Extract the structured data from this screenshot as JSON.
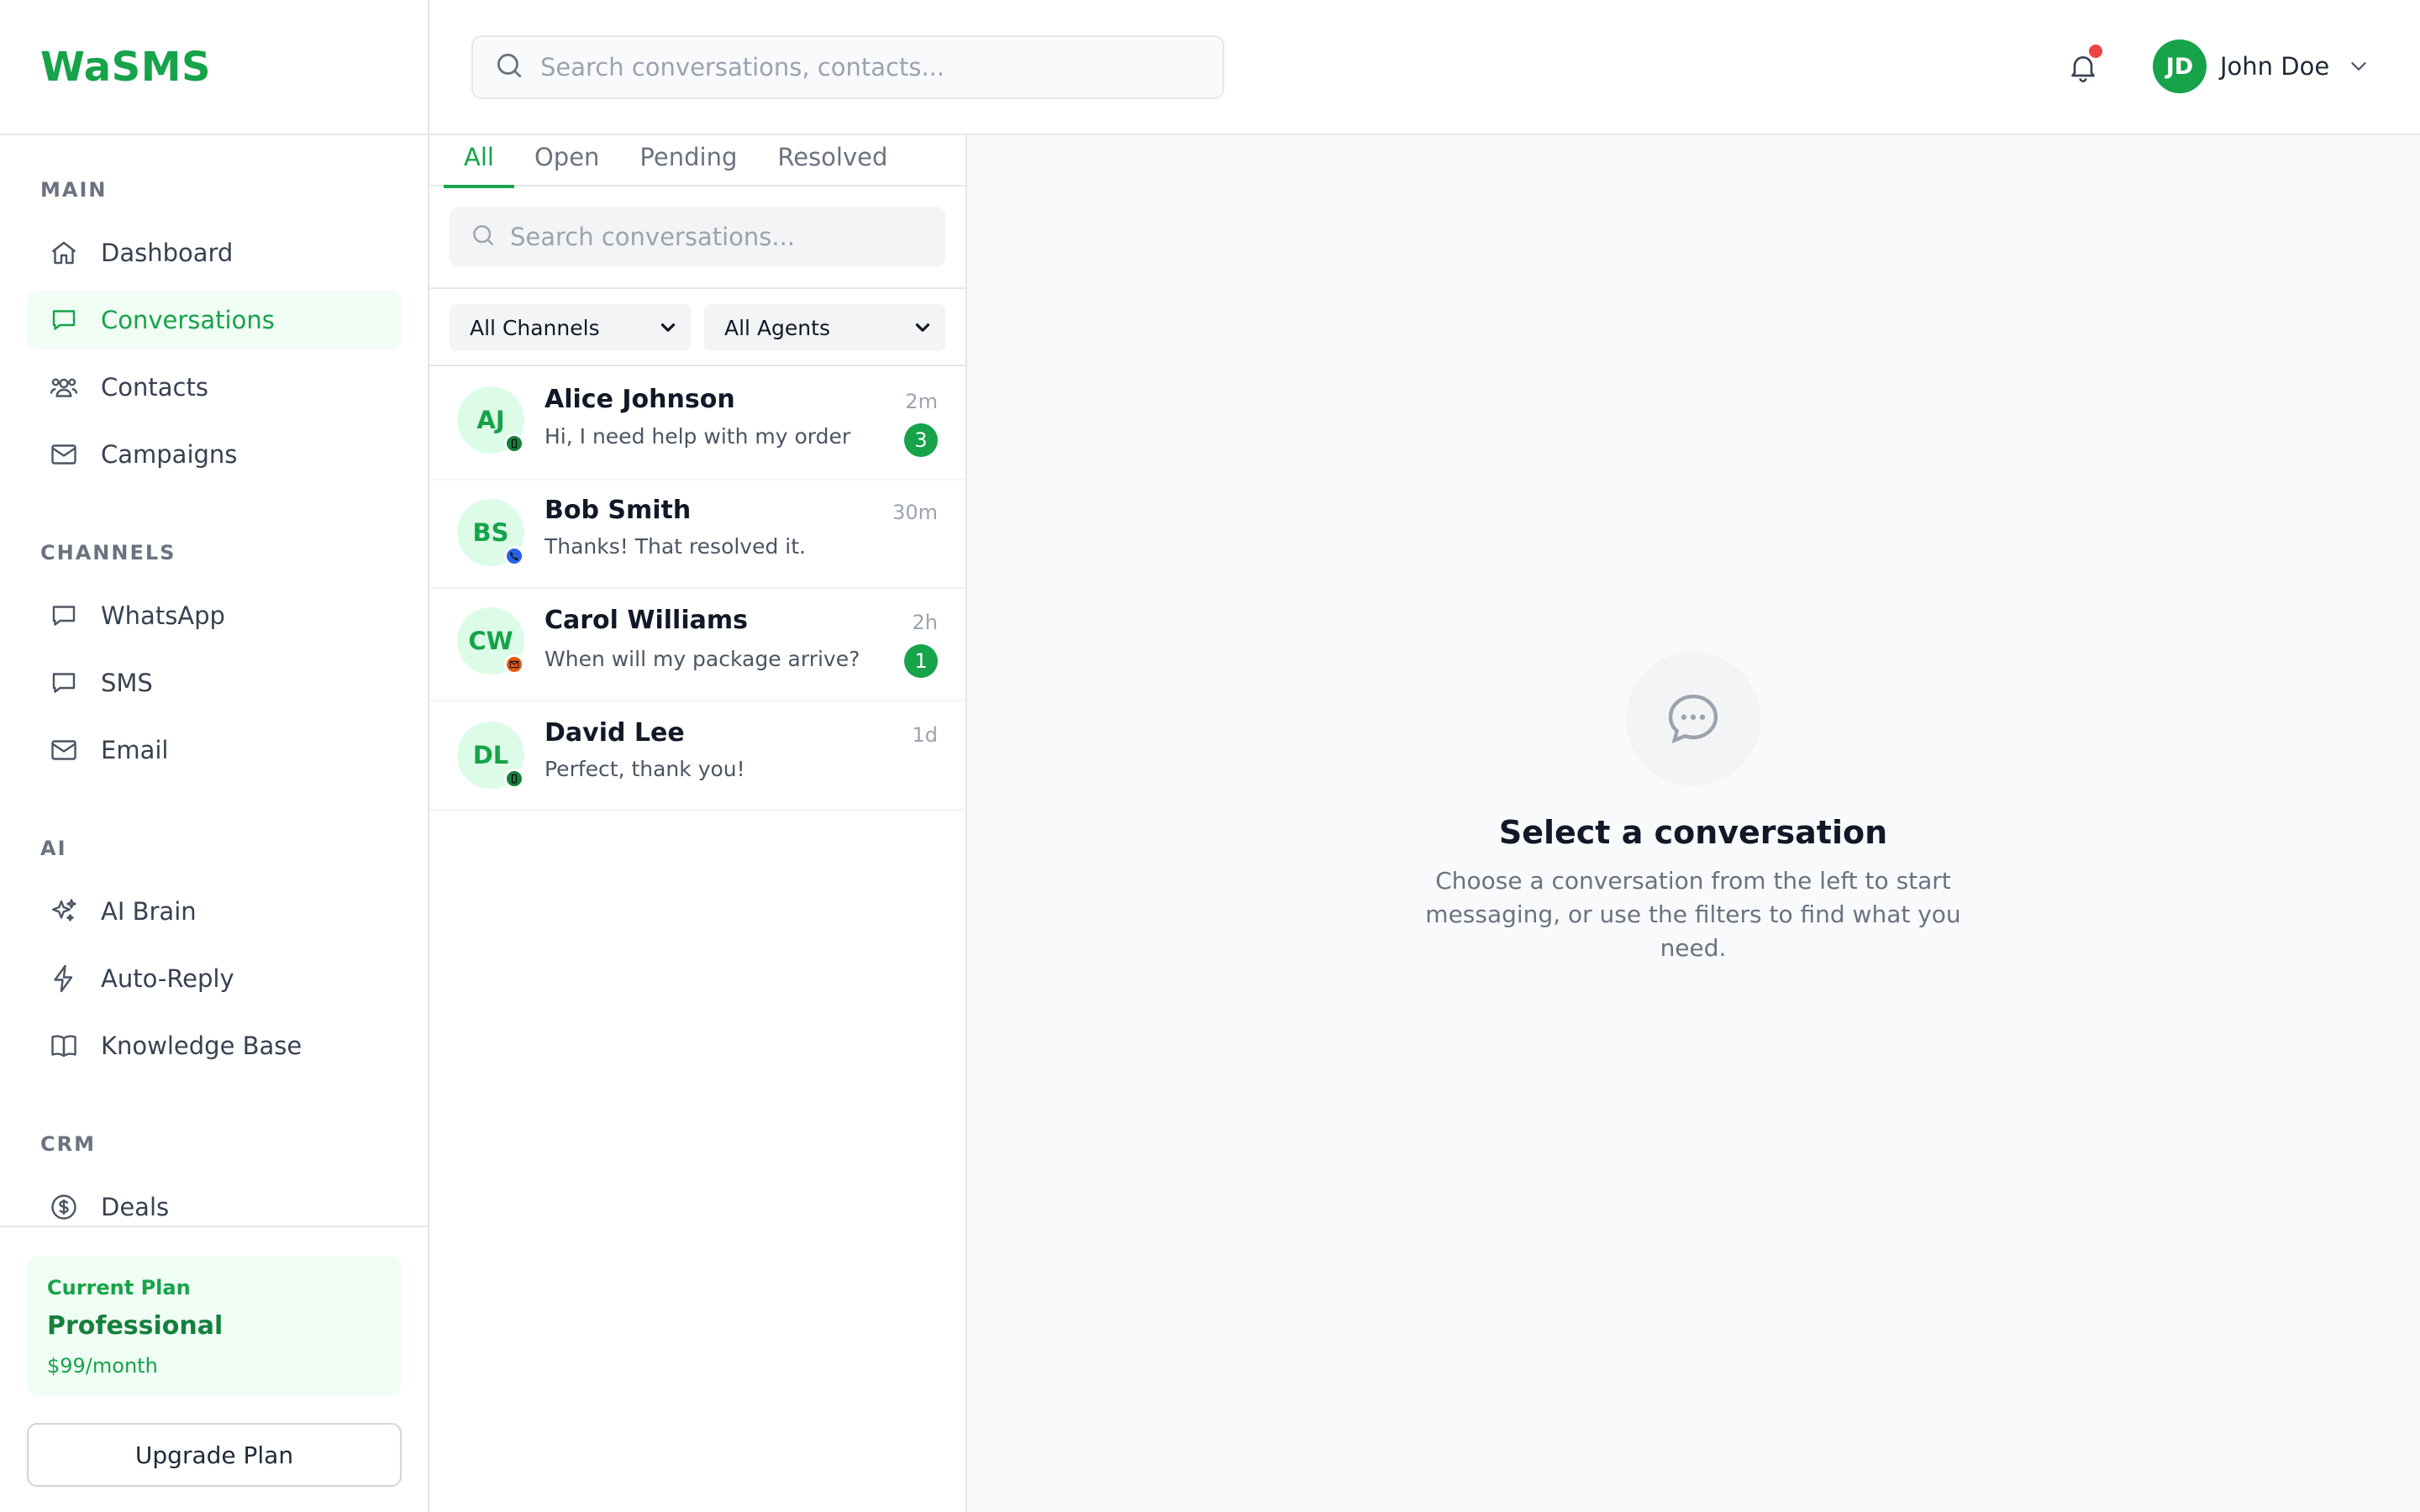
{
  "app": {
    "brand": "WaSMS"
  },
  "header": {
    "search_placeholder": "Search conversations, contacts...",
    "user": {
      "initials": "JD",
      "name": "John Doe"
    }
  },
  "sidebar": {
    "sections": [
      {
        "title": "MAIN",
        "items": [
          {
            "label": "Dashboard",
            "icon": "home-icon"
          },
          {
            "label": "Conversations",
            "icon": "chat-icon",
            "active": true
          },
          {
            "label": "Contacts",
            "icon": "users-icon"
          },
          {
            "label": "Campaigns",
            "icon": "mail-icon"
          }
        ]
      },
      {
        "title": "CHANNELS",
        "items": [
          {
            "label": "WhatsApp",
            "icon": "chat-icon"
          },
          {
            "label": "SMS",
            "icon": "chat-icon"
          },
          {
            "label": "Email",
            "icon": "mail-icon"
          }
        ]
      },
      {
        "title": "AI",
        "items": [
          {
            "label": "AI Brain",
            "icon": "sparkles-icon"
          },
          {
            "label": "Auto-Reply",
            "icon": "bolt-icon"
          },
          {
            "label": "Knowledge Base",
            "icon": "book-icon"
          }
        ]
      },
      {
        "title": "CRM",
        "items": [
          {
            "label": "Deals",
            "icon": "dollar-icon"
          }
        ]
      }
    ],
    "plan": {
      "label": "Current Plan",
      "name": "Professional",
      "price": "$99/month"
    },
    "upgrade_label": "Upgrade Plan"
  },
  "conversations": {
    "tabs": [
      {
        "label": "All",
        "active": true
      },
      {
        "label": "Open"
      },
      {
        "label": "Pending"
      },
      {
        "label": "Resolved"
      }
    ],
    "search_placeholder": "Search conversations...",
    "filters": {
      "channel": "All Channels",
      "agent": "All Agents"
    },
    "items": [
      {
        "initials": "AJ",
        "name": "Alice Johnson",
        "message": "Hi, I need help with my order",
        "time": "2m",
        "unread": "3",
        "channel_icon": "phone-icon",
        "channel_color": "#15803d"
      },
      {
        "initials": "BS",
        "name": "Bob Smith",
        "message": "Thanks! That resolved it.",
        "time": "30m",
        "unread": null,
        "channel_icon": "telephone-icon",
        "channel_color": "#2563eb"
      },
      {
        "initials": "CW",
        "name": "Carol Williams",
        "message": "When will my package arrive?",
        "time": "2h",
        "unread": "1",
        "channel_icon": "envelope-icon",
        "channel_color": "#ea580c"
      },
      {
        "initials": "DL",
        "name": "David Lee",
        "message": "Perfect, thank you!",
        "time": "1d",
        "unread": null,
        "channel_icon": "phone-icon",
        "channel_color": "#15803d"
      }
    ]
  },
  "empty_state": {
    "title": "Select a conversation",
    "text": "Choose a conversation from the left to start messaging, or use the filters to find what you need."
  },
  "colors": {
    "accent": "#16a34a",
    "accent_light": "#f0fdf4",
    "notification": "#ef4444"
  }
}
